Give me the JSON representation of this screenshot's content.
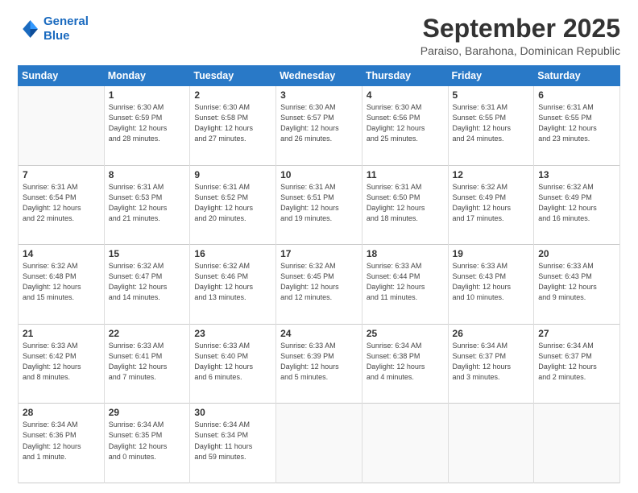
{
  "logo": {
    "line1": "General",
    "line2": "Blue"
  },
  "title": "September 2025",
  "location": "Paraiso, Barahona, Dominican Republic",
  "days_of_week": [
    "Sunday",
    "Monday",
    "Tuesday",
    "Wednesday",
    "Thursday",
    "Friday",
    "Saturday"
  ],
  "weeks": [
    [
      {
        "day": "",
        "info": ""
      },
      {
        "day": "1",
        "info": "Sunrise: 6:30 AM\nSunset: 6:59 PM\nDaylight: 12 hours\nand 28 minutes."
      },
      {
        "day": "2",
        "info": "Sunrise: 6:30 AM\nSunset: 6:58 PM\nDaylight: 12 hours\nand 27 minutes."
      },
      {
        "day": "3",
        "info": "Sunrise: 6:30 AM\nSunset: 6:57 PM\nDaylight: 12 hours\nand 26 minutes."
      },
      {
        "day": "4",
        "info": "Sunrise: 6:30 AM\nSunset: 6:56 PM\nDaylight: 12 hours\nand 25 minutes."
      },
      {
        "day": "5",
        "info": "Sunrise: 6:31 AM\nSunset: 6:55 PM\nDaylight: 12 hours\nand 24 minutes."
      },
      {
        "day": "6",
        "info": "Sunrise: 6:31 AM\nSunset: 6:55 PM\nDaylight: 12 hours\nand 23 minutes."
      }
    ],
    [
      {
        "day": "7",
        "info": "Sunrise: 6:31 AM\nSunset: 6:54 PM\nDaylight: 12 hours\nand 22 minutes."
      },
      {
        "day": "8",
        "info": "Sunrise: 6:31 AM\nSunset: 6:53 PM\nDaylight: 12 hours\nand 21 minutes."
      },
      {
        "day": "9",
        "info": "Sunrise: 6:31 AM\nSunset: 6:52 PM\nDaylight: 12 hours\nand 20 minutes."
      },
      {
        "day": "10",
        "info": "Sunrise: 6:31 AM\nSunset: 6:51 PM\nDaylight: 12 hours\nand 19 minutes."
      },
      {
        "day": "11",
        "info": "Sunrise: 6:31 AM\nSunset: 6:50 PM\nDaylight: 12 hours\nand 18 minutes."
      },
      {
        "day": "12",
        "info": "Sunrise: 6:32 AM\nSunset: 6:49 PM\nDaylight: 12 hours\nand 17 minutes."
      },
      {
        "day": "13",
        "info": "Sunrise: 6:32 AM\nSunset: 6:49 PM\nDaylight: 12 hours\nand 16 minutes."
      }
    ],
    [
      {
        "day": "14",
        "info": "Sunrise: 6:32 AM\nSunset: 6:48 PM\nDaylight: 12 hours\nand 15 minutes."
      },
      {
        "day": "15",
        "info": "Sunrise: 6:32 AM\nSunset: 6:47 PM\nDaylight: 12 hours\nand 14 minutes."
      },
      {
        "day": "16",
        "info": "Sunrise: 6:32 AM\nSunset: 6:46 PM\nDaylight: 12 hours\nand 13 minutes."
      },
      {
        "day": "17",
        "info": "Sunrise: 6:32 AM\nSunset: 6:45 PM\nDaylight: 12 hours\nand 12 minutes."
      },
      {
        "day": "18",
        "info": "Sunrise: 6:33 AM\nSunset: 6:44 PM\nDaylight: 12 hours\nand 11 minutes."
      },
      {
        "day": "19",
        "info": "Sunrise: 6:33 AM\nSunset: 6:43 PM\nDaylight: 12 hours\nand 10 minutes."
      },
      {
        "day": "20",
        "info": "Sunrise: 6:33 AM\nSunset: 6:43 PM\nDaylight: 12 hours\nand 9 minutes."
      }
    ],
    [
      {
        "day": "21",
        "info": "Sunrise: 6:33 AM\nSunset: 6:42 PM\nDaylight: 12 hours\nand 8 minutes."
      },
      {
        "day": "22",
        "info": "Sunrise: 6:33 AM\nSunset: 6:41 PM\nDaylight: 12 hours\nand 7 minutes."
      },
      {
        "day": "23",
        "info": "Sunrise: 6:33 AM\nSunset: 6:40 PM\nDaylight: 12 hours\nand 6 minutes."
      },
      {
        "day": "24",
        "info": "Sunrise: 6:33 AM\nSunset: 6:39 PM\nDaylight: 12 hours\nand 5 minutes."
      },
      {
        "day": "25",
        "info": "Sunrise: 6:34 AM\nSunset: 6:38 PM\nDaylight: 12 hours\nand 4 minutes."
      },
      {
        "day": "26",
        "info": "Sunrise: 6:34 AM\nSunset: 6:37 PM\nDaylight: 12 hours\nand 3 minutes."
      },
      {
        "day": "27",
        "info": "Sunrise: 6:34 AM\nSunset: 6:37 PM\nDaylight: 12 hours\nand 2 minutes."
      }
    ],
    [
      {
        "day": "28",
        "info": "Sunrise: 6:34 AM\nSunset: 6:36 PM\nDaylight: 12 hours\nand 1 minute."
      },
      {
        "day": "29",
        "info": "Sunrise: 6:34 AM\nSunset: 6:35 PM\nDaylight: 12 hours\nand 0 minutes."
      },
      {
        "day": "30",
        "info": "Sunrise: 6:34 AM\nSunset: 6:34 PM\nDaylight: 11 hours\nand 59 minutes."
      },
      {
        "day": "",
        "info": ""
      },
      {
        "day": "",
        "info": ""
      },
      {
        "day": "",
        "info": ""
      },
      {
        "day": "",
        "info": ""
      }
    ]
  ]
}
